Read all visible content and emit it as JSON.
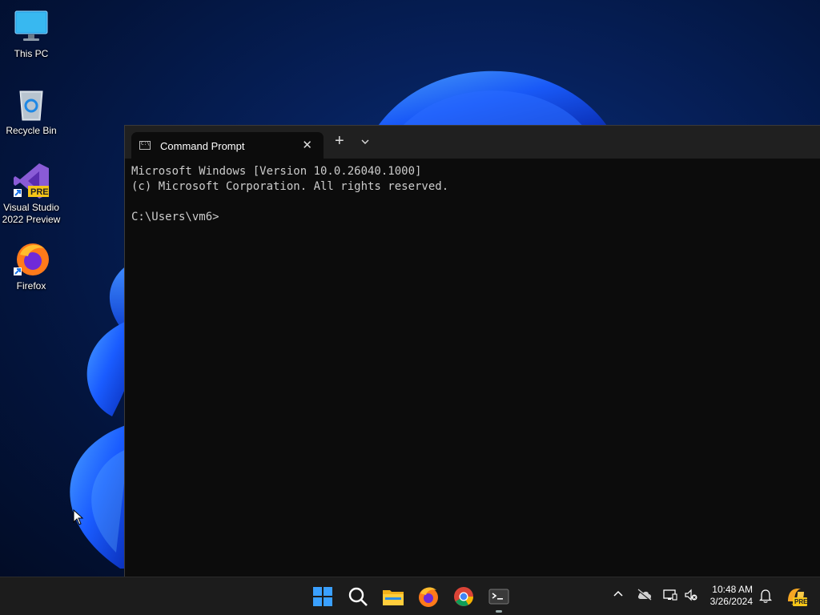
{
  "desktop": {
    "icons": [
      {
        "label": "This PC"
      },
      {
        "label": "Recycle Bin"
      },
      {
        "label": "Visual Studio 2022 Preview",
        "badge": "PRE"
      },
      {
        "label": "Firefox"
      }
    ]
  },
  "terminal": {
    "tab_title": "Command Prompt",
    "close_glyph": "✕",
    "new_tab_glyph": "+",
    "dropdown_glyph": "⌄",
    "lines": [
      "Microsoft Windows [Version 10.0.26040.1000]",
      "(c) Microsoft Corporation. All rights reserved.",
      "",
      "C:\\Users\\vm6>"
    ]
  },
  "taskbar": {
    "apps": [
      "start-icon",
      "search-icon",
      "file-explorer-icon",
      "firefox-icon",
      "chrome-icon",
      "terminal-icon"
    ],
    "clock": {
      "time": "10:48 AM",
      "date": "3/26/2024"
    },
    "copilot_badge": "PRE"
  },
  "colors": {
    "accent": "#1f6fff",
    "terminal_bg": "#0c0c0c",
    "titlebar_bg": "#202020",
    "taskbar_bg": "#1c1c1c"
  }
}
